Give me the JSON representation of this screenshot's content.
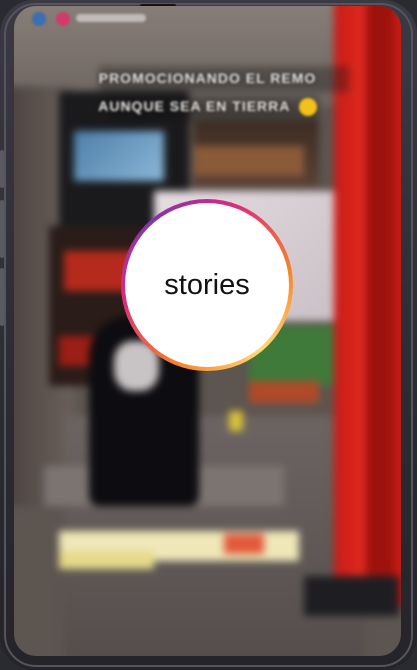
{
  "story_overlay": {
    "caption_line1": "PROMOCIONANDO EL REMO",
    "caption_line2": "AUNQUE SEA EN TIERRA",
    "emoji": "grinning-face-emoji",
    "center_label": "stories",
    "ring_colors": [
      "#f58529",
      "#dd2a7b",
      "#8134af",
      "#feda77"
    ]
  },
  "colors": {
    "accent_red": "#e02a20",
    "screen_bg": "#5d5550"
  }
}
